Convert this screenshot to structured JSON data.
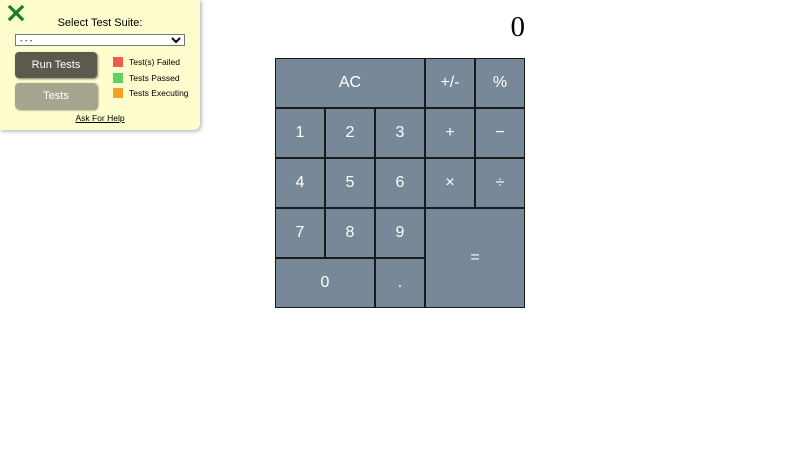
{
  "test_panel": {
    "close_icon": "close-x-icon",
    "close_color": "#1e7d1e",
    "title": "Select Test Suite:",
    "suite_select": {
      "selected": "- - -"
    },
    "run_tests_label": "Run Tests",
    "tests_label": "Tests",
    "legend": [
      {
        "label": "Test(s) Failed",
        "color": "#f05a4a"
      },
      {
        "label": "Tests Passed",
        "color": "#5fd35f"
      },
      {
        "label": "Tests Executing",
        "color": "#f5a020"
      }
    ],
    "help_link": "Ask For Help"
  },
  "calculator": {
    "display": "0",
    "key_color": "#778899",
    "keys": {
      "ac": "AC",
      "sign": "+/-",
      "percent": "%",
      "one": "1",
      "two": "2",
      "three": "3",
      "add": "+",
      "subtract": "−",
      "four": "4",
      "five": "5",
      "six": "6",
      "multiply": "×",
      "divide": "÷",
      "seven": "7",
      "eight": "8",
      "nine": "9",
      "equals": "=",
      "zero": "0",
      "decimal": "."
    }
  }
}
